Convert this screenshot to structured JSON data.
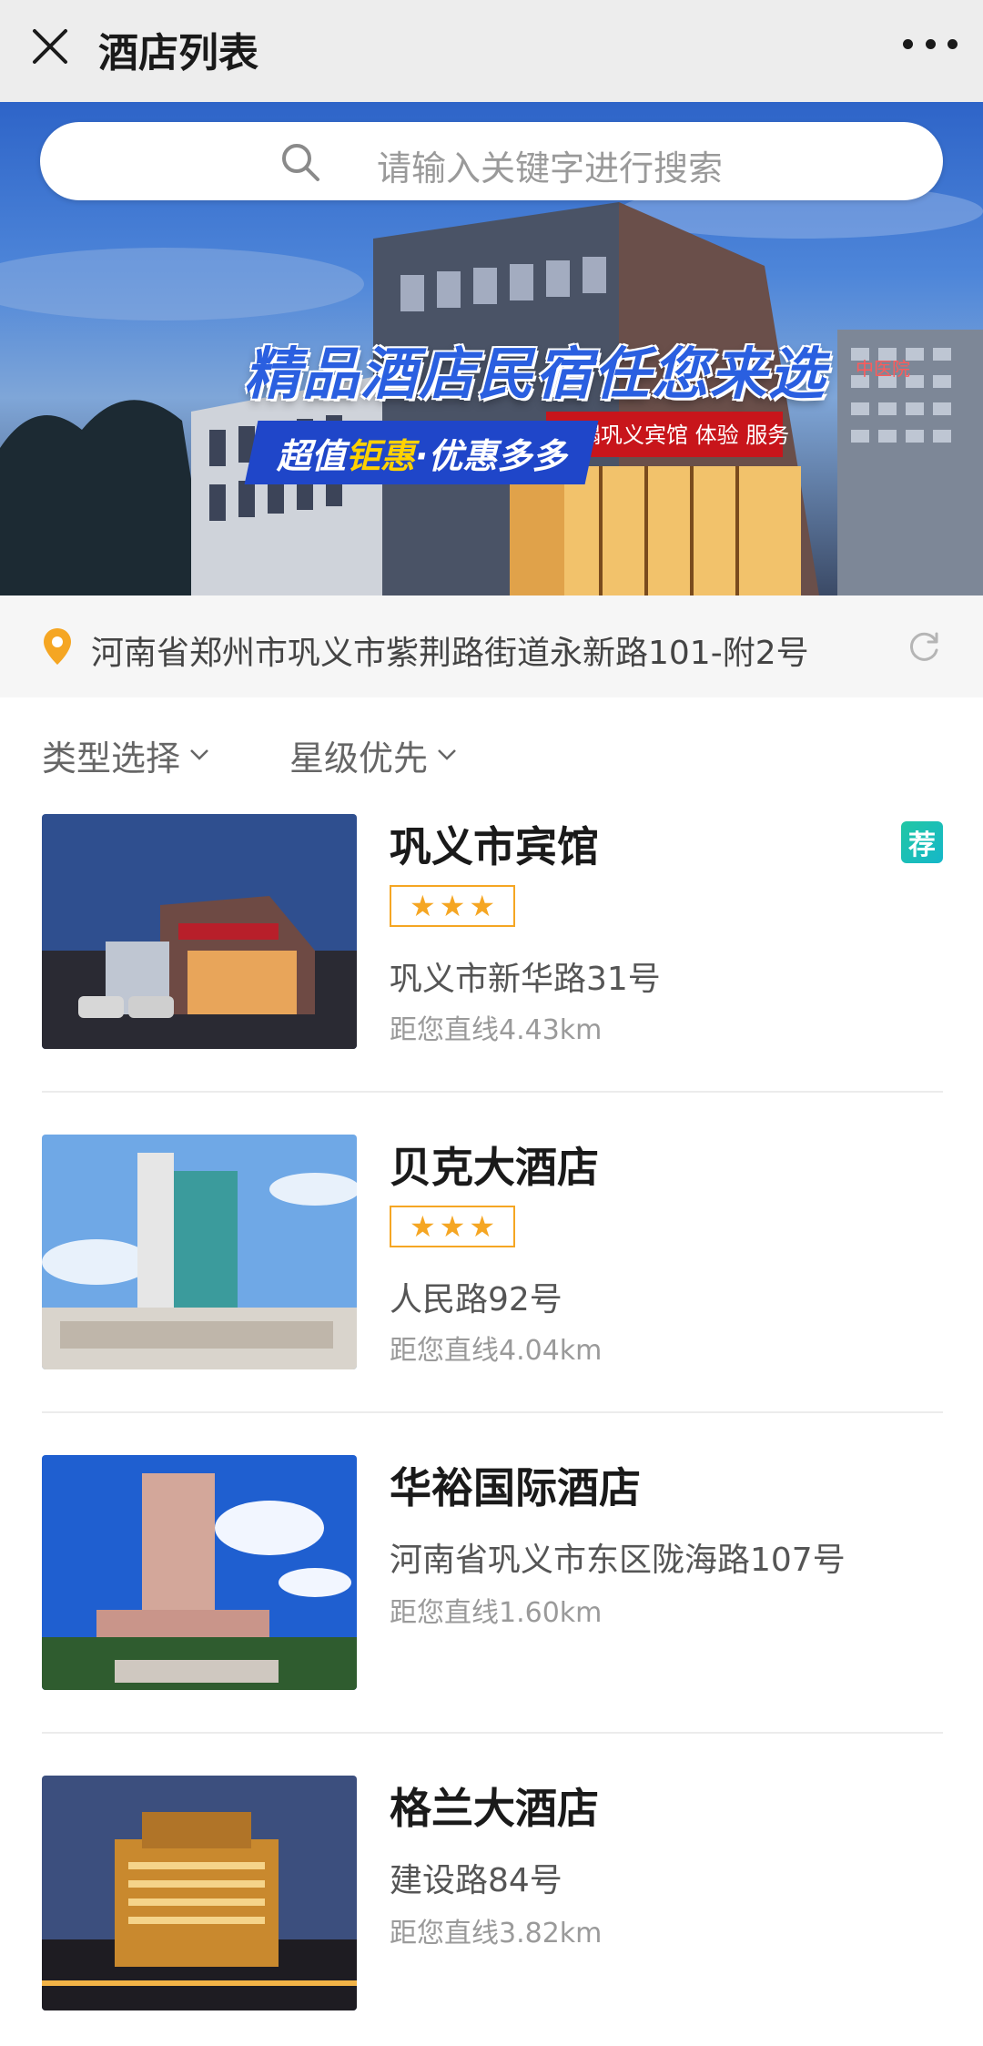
{
  "nav": {
    "title": "酒店列表",
    "close_icon": "close-icon",
    "more_icon": "more-dots-icon"
  },
  "search": {
    "placeholder": "请输入关键字进行搜索"
  },
  "banner": {
    "headline": "精品酒店民宿任您来选",
    "badge_prefix": "超值",
    "badge_highlight": "钜惠",
    "badge_suffix": "·优惠多多",
    "sign_text": "下榻巩义宾馆 体验 服务",
    "side_sign": "中医院"
  },
  "location": {
    "address": "河南省郑州市巩义市紫荆路街道永新路101-附2号",
    "pin_color": "#f5a623"
  },
  "filters": [
    {
      "label": "类型选择"
    },
    {
      "label": "星级优先"
    }
  ],
  "hotels": [
    {
      "name": "巩义市宾馆",
      "stars": 3,
      "address": "巩义市新华路31号",
      "distance": "距您直线4.43km",
      "badge": "荐"
    },
    {
      "name": "贝克大酒店",
      "stars": 3,
      "address": "人民路92号",
      "distance": "距您直线4.04km"
    },
    {
      "name": "华裕国际酒店",
      "stars": 0,
      "address": "河南省巩义市东区陇海路107号",
      "distance": "距您直线1.60km"
    },
    {
      "name": "格兰大酒店",
      "stars": 0,
      "address": "建设路84号",
      "distance": "距您直线3.82km"
    }
  ],
  "colors": {
    "accent": "#f5a623",
    "badge": "#22c7a4",
    "nav_bg": "#ededed"
  }
}
